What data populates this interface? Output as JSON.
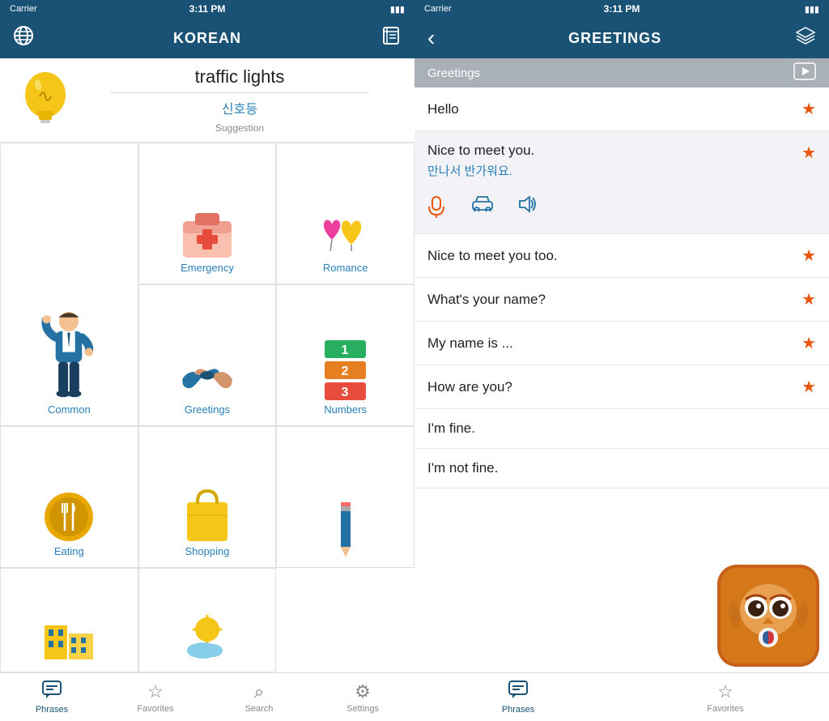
{
  "leftPhone": {
    "statusBar": {
      "carrier": "Carrier",
      "wifi": "▾",
      "time": "3:11 PM",
      "battery": "🔋"
    },
    "navBar": {
      "title": "KOREAN",
      "leftIcon": "globe",
      "rightIcon": "book"
    },
    "suggestion": {
      "label": "Suggestion",
      "english": "traffic lights",
      "korean": "신호등"
    },
    "categories": [
      {
        "id": "common",
        "label": "Common"
      },
      {
        "id": "emergency",
        "label": "Emergency"
      },
      {
        "id": "romance",
        "label": "Romance"
      },
      {
        "id": "greetings",
        "label": "Greetings"
      },
      {
        "id": "numbers",
        "label": "Numbers"
      },
      {
        "id": "eating",
        "label": "Eating"
      },
      {
        "id": "shopping",
        "label": "Shopping"
      },
      {
        "id": "numbers2",
        "label": ""
      },
      {
        "id": "pencil",
        "label": ""
      },
      {
        "id": "buildings",
        "label": ""
      },
      {
        "id": "sun",
        "label": ""
      }
    ],
    "tabBar": {
      "tabs": [
        {
          "id": "phrases",
          "label": "Phrases",
          "active": true
        },
        {
          "id": "favorites",
          "label": "Favorites",
          "active": false
        },
        {
          "id": "search",
          "label": "Search",
          "active": false
        },
        {
          "id": "settings",
          "label": "Settings",
          "active": false
        }
      ]
    }
  },
  "rightPhone": {
    "statusBar": {
      "carrier": "Carrier",
      "time": "3:11 PM",
      "battery": "🔋"
    },
    "navBar": {
      "title": "GREETINGS",
      "backLabel": "‹",
      "rightIcon": "layers"
    },
    "sectionHeader": "Greetings",
    "phrases": [
      {
        "id": "hello",
        "text": "Hello",
        "korean": "",
        "expanded": false,
        "starred": true
      },
      {
        "id": "nice-meet",
        "text": "Nice to meet you.",
        "korean": "만나서 반가워요.",
        "expanded": true,
        "starred": true
      },
      {
        "id": "nice-meet-too",
        "text": "Nice to meet you too.",
        "korean": "",
        "expanded": false,
        "starred": true
      },
      {
        "id": "whats-name",
        "text": "What's your name?",
        "korean": "",
        "expanded": false,
        "starred": true
      },
      {
        "id": "my-name",
        "text": "My name is ...",
        "korean": "",
        "expanded": false,
        "starred": true
      },
      {
        "id": "how-are-you",
        "text": "How are you?",
        "korean": "",
        "expanded": false,
        "starred": true
      },
      {
        "id": "im-fine",
        "text": "I'm fine.",
        "korean": "",
        "expanded": false,
        "starred": false
      },
      {
        "id": "not-fine",
        "text": "I'm not fine.",
        "korean": "",
        "expanded": false,
        "starred": false
      }
    ],
    "tabBar": {
      "tabs": [
        {
          "id": "phrases",
          "label": "Phrases",
          "active": true
        },
        {
          "id": "favorites",
          "label": "Favorites",
          "active": false
        }
      ]
    }
  },
  "colors": {
    "navBlue": "#1a5276",
    "linkBlue": "#2980b9",
    "orange": "#e8570d",
    "sectionGray": "#aab0b8"
  }
}
